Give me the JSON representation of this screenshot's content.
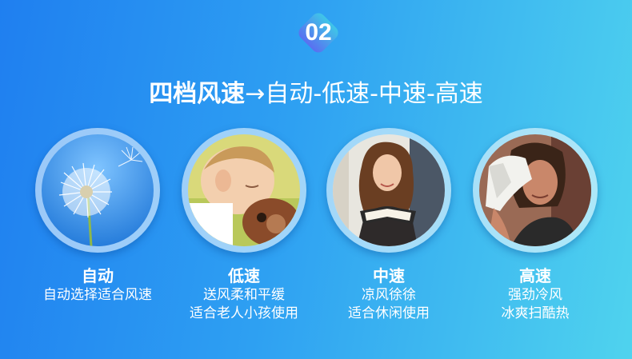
{
  "badge": {
    "number": "02"
  },
  "headline": {
    "strong": "四档风速",
    "rest": "→自动-低速-中速-高速"
  },
  "features": [
    {
      "title": "自动",
      "lines": [
        "自动选择适合风速"
      ],
      "image": "dandelion-icon"
    },
    {
      "title": "低速",
      "lines": [
        "送风柔和平缓",
        "适合老人小孩使用"
      ],
      "image": "sleeping-baby-icon"
    },
    {
      "title": "中速",
      "lines": [
        "凉风徐徐",
        "适合休闲使用"
      ],
      "image": "reading-woman-icon"
    },
    {
      "title": "高速",
      "lines": [
        "强劲冷风",
        "冰爽扫酷热"
      ],
      "image": "sweating-athlete-icon"
    }
  ],
  "colors": {
    "gradient_start": "#1f7ff0",
    "gradient_end": "#4fd3ee",
    "badge_top": "#3fc6e8",
    "badge_bottom": "#5a6ff0"
  }
}
